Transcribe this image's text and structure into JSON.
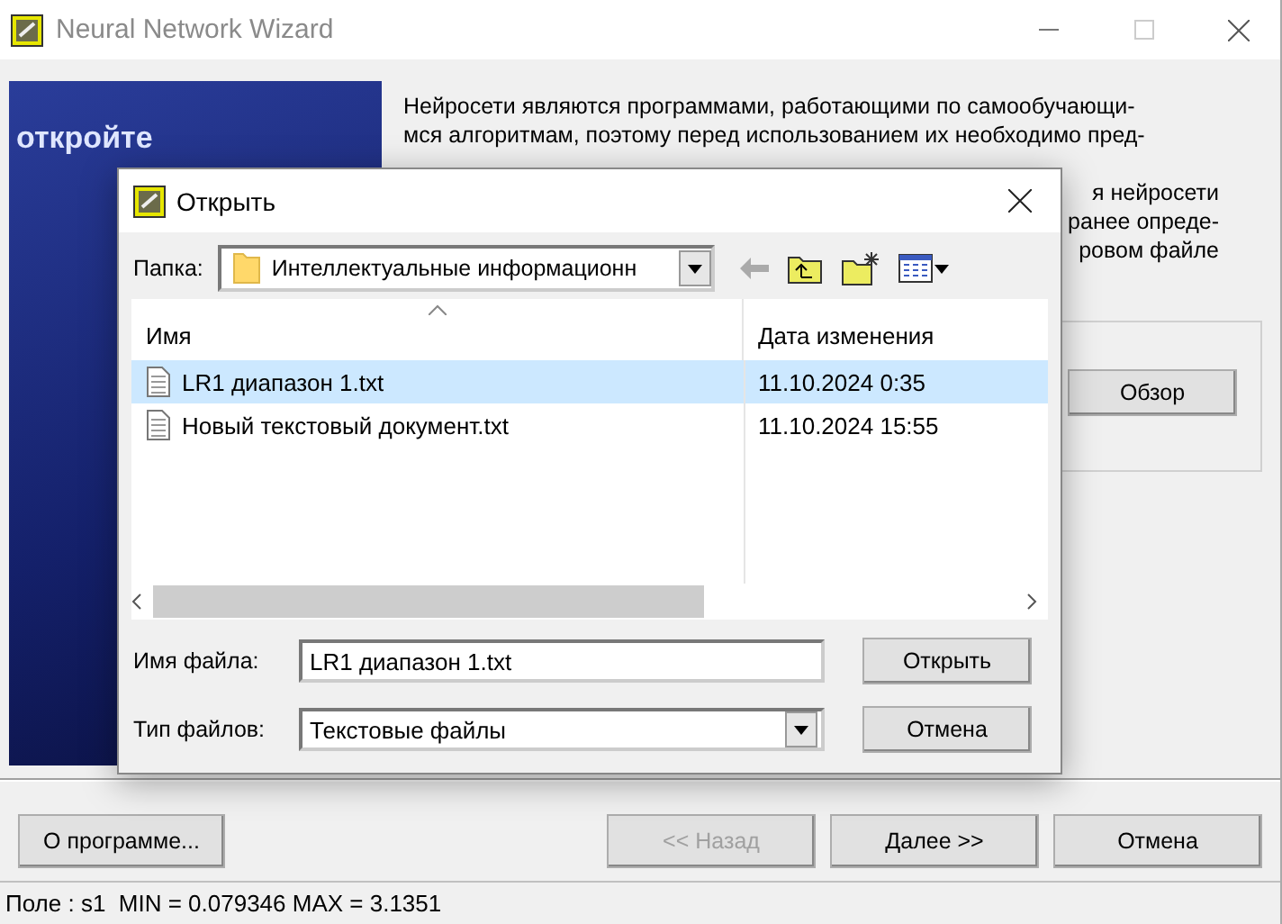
{
  "window": {
    "title": "Neural Network Wizard",
    "active": false
  },
  "banner": {
    "headline": "откройте"
  },
  "intro_lines": [
    "Нейросети  являются программами, работающими по самообучающи-",
    "мся алгоритмам, поэтому перед использованием их необходимо пред-"
  ],
  "intro_fragments": [
    "я  нейросети",
    "ранее опреде-",
    "ровом  файле"
  ],
  "browse_button": "Обзор",
  "buttons": [
    {
      "label": "О программе...",
      "disabled": false
    },
    {
      "label": "<< Назад",
      "disabled": true
    },
    {
      "label": "Далее >>",
      "disabled": false
    },
    {
      "label": "Отмена",
      "disabled": false
    }
  ],
  "status_bar": "Поле : s1  MIN = 0.079346 MAX = 3.1351",
  "dialog": {
    "title": "Открыть",
    "folder_label": "Папка:",
    "folder": "Интеллектуальные информационн",
    "columns": [
      "Имя",
      "Дата изменения"
    ],
    "files": [
      {
        "name": "LR1 диапазон 1.txt",
        "modified": "11.10.2024 0:35",
        "selected": true
      },
      {
        "name": "Новый текстовый документ.txt",
        "modified": "11.10.2024 15:55",
        "selected": false
      }
    ],
    "filename_label": "Имя файла:",
    "filename": "LR1 диапазон 1.txt",
    "filetype_label": "Тип файлов:",
    "filetype": "Текстовые файлы",
    "open_button": "Открыть",
    "cancel_button": "Отмена"
  }
}
